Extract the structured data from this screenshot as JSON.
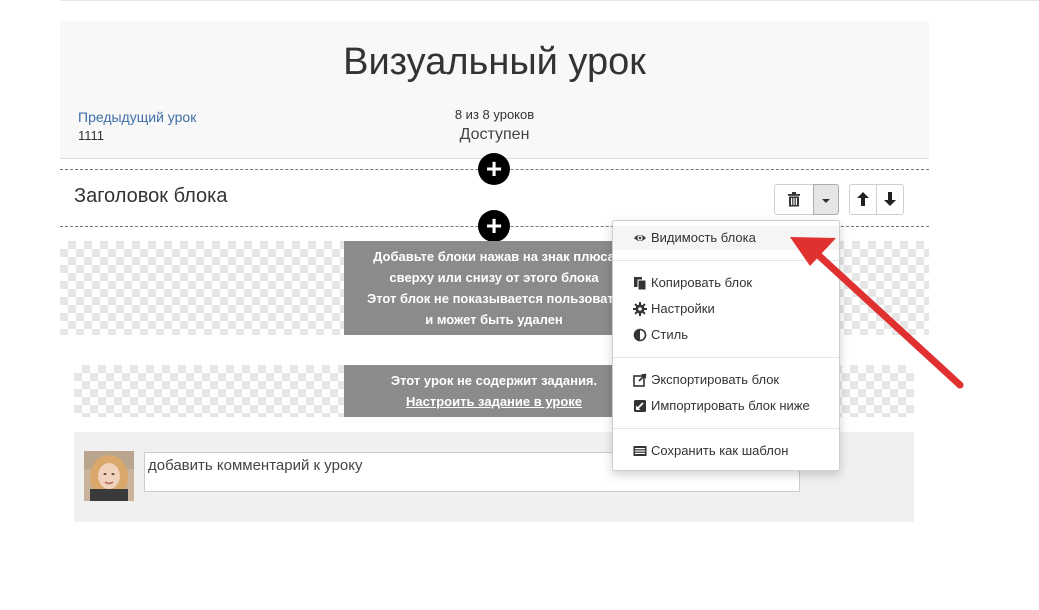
{
  "lesson": {
    "title": "Визуальный урок",
    "prev_link": "Предыдущий урок",
    "prev_name": "1111",
    "count": "8 из 8 уроков",
    "status": "Доступен"
  },
  "block": {
    "title": "Заголовок блока",
    "notice_lines": [
      "Добавьте блоки нажав на знак плюса",
      "сверху или снизу от этого блока",
      "Этот блок не показывается пользовате",
      "и может быть удален"
    ]
  },
  "task_notice": {
    "text": "Этот урок не содержит задания.",
    "link": "Настроить задание в уроке"
  },
  "comment": {
    "placeholder": "добавить комментарий к уроку"
  },
  "menu": {
    "items": [
      {
        "label": "Видимость блока",
        "icon": "eye-icon"
      },
      {
        "label": "Копировать блок",
        "icon": "copy-icon"
      },
      {
        "label": "Настройки",
        "icon": "gear-icon"
      },
      {
        "label": "Стиль",
        "icon": "half-circle-icon"
      },
      {
        "label": "Экспортировать блок",
        "icon": "external-link-icon"
      },
      {
        "label": "Импортировать блок ниже",
        "icon": "import-icon"
      },
      {
        "label": "Сохранить как шаблон",
        "icon": "template-icon"
      }
    ]
  },
  "colors": {
    "accent_arrow": "#e03030",
    "link": "#3f6fa8",
    "notice_bg": "#8b8b8b"
  }
}
